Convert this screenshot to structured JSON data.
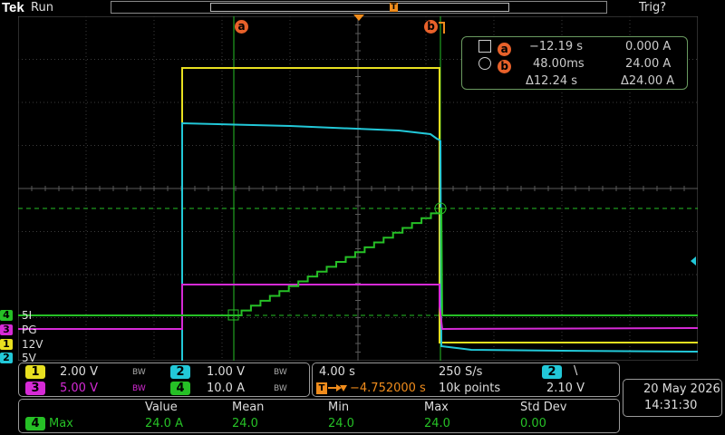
{
  "header": {
    "brand": "Tek",
    "status": "Run",
    "trigger_status": "Trig?",
    "trigger_marker": "T"
  },
  "cursors": {
    "a_label": "a",
    "b_label": "b",
    "row_a": {
      "time": "−12.19 s",
      "value": "0.000 A"
    },
    "row_b": {
      "time": "48.00ms",
      "value": "24.00 A"
    },
    "delta": {
      "time": "Δ12.24 s",
      "value": "Δ24.00 A"
    }
  },
  "channels": [
    {
      "num": "4",
      "name": "5I",
      "color": "#26c026"
    },
    {
      "num": "3",
      "name": "PG",
      "color": "#d62ad6"
    },
    {
      "num": "1",
      "name": "12V",
      "color": "#e8e020"
    },
    {
      "num": "2",
      "name": "5V",
      "color": "#22c8d8"
    }
  ],
  "vertical": {
    "ch1": {
      "num": "1",
      "scale": "2.00 V",
      "bw": "BW",
      "color": "#e8e020"
    },
    "ch2": {
      "num": "2",
      "scale": "1.00 V",
      "bw": "BW",
      "color": "#22c8d8"
    },
    "ch3": {
      "num": "3",
      "scale": "5.00 V",
      "bw": "BW",
      "color": "#d62ad6"
    },
    "ch4": {
      "num": "4",
      "scale": "10.0 A",
      "bw": "BW",
      "color": "#26c026"
    }
  },
  "horizontal": {
    "time_div": "4.00 s",
    "sample_rate": "250 S/s",
    "delay": "−4.752000 s",
    "record": "10k points",
    "trig_marker": "T"
  },
  "trigger": {
    "source": "2",
    "slope": "\\",
    "level": "2.10 V",
    "color": "#22c8d8"
  },
  "datetime": {
    "date": "20 May  2026",
    "time": "14:31:30"
  },
  "measurement": {
    "headers": [
      "Value",
      "Mean",
      "Min",
      "Max",
      "Std Dev"
    ],
    "channel": "4",
    "name": "Max",
    "values": [
      "24.0 A",
      "24.0",
      "24.0",
      "24.0",
      "0.00"
    ]
  }
}
